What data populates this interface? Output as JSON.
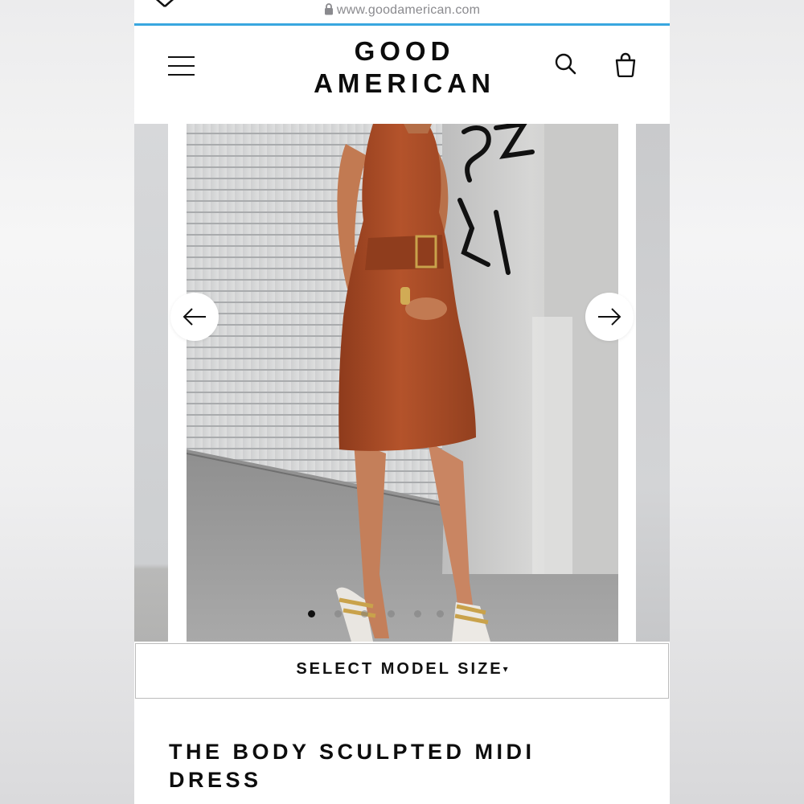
{
  "browser": {
    "url": "www.goodamerican.com",
    "close_icon": "close-icon",
    "lock_icon": "lock-icon",
    "accent_color": "#39a7df"
  },
  "header": {
    "logo_line1": "GOOD",
    "logo_line2": "AMERICAN",
    "menu_icon": "hamburger-menu-icon",
    "search_icon": "search-icon",
    "bag_icon": "shopping-bag-icon"
  },
  "carousel": {
    "prev_icon": "arrow-left-icon",
    "next_icon": "arrow-right-icon",
    "image_count": 6,
    "active_index": 0,
    "main_image": "model-in-rust-midi-dress-photo"
  },
  "size_select": {
    "label": "SELECT MODEL SIZE",
    "caret": "▾"
  },
  "product": {
    "title": "THE BODY SCULPTED MIDI DRESS"
  }
}
